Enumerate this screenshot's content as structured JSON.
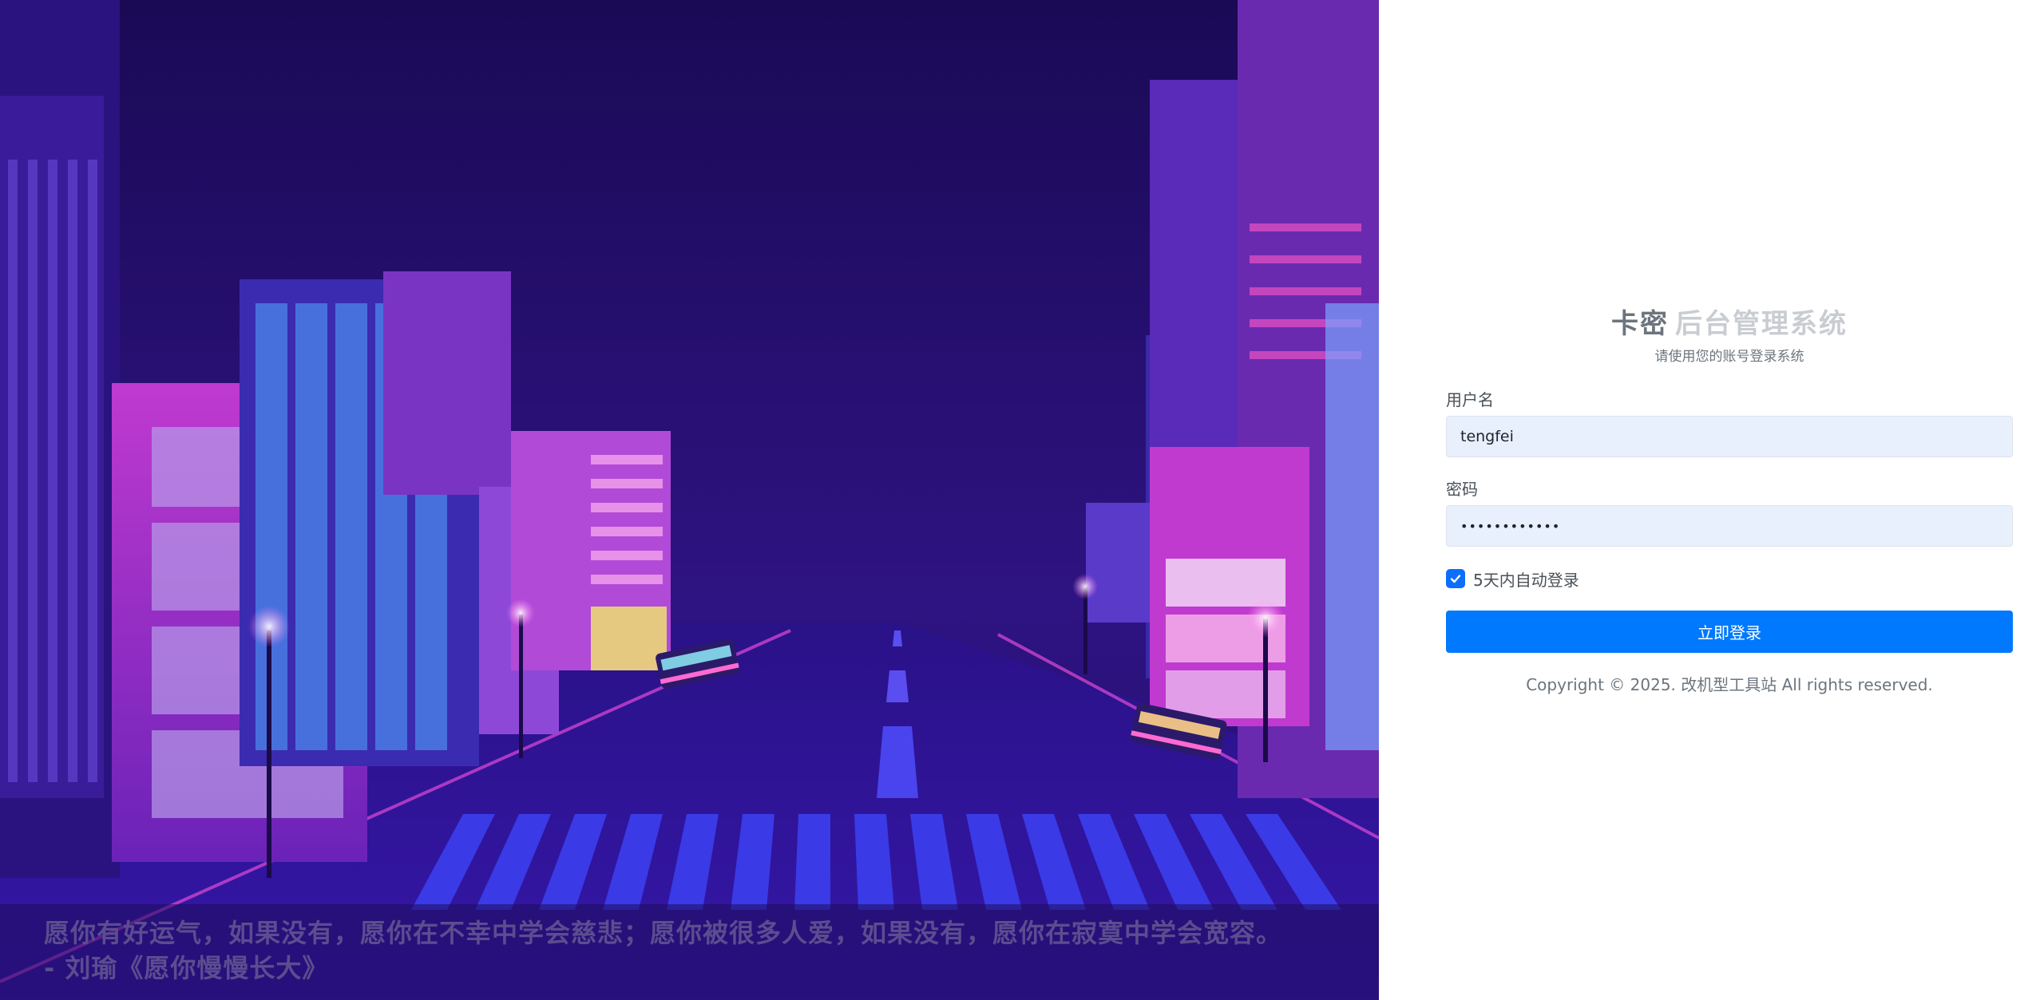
{
  "hero": {
    "quote": "愿你有好运气，如果没有，愿你在不幸中学会慈悲；愿你被很多人爱，如果没有，愿你在寂寞中学会宽容。 - 刘瑜《愿你慢慢长大》"
  },
  "login": {
    "title_main": "卡密",
    "title_sub": "后台管理系统",
    "subtitle": "请使用您的账号登录系统",
    "username_label": "用户名",
    "username_value": "tengfei",
    "password_label": "密码",
    "password_value": "••••••••••••",
    "remember_label": "5天内自动登录",
    "remember_checked": true,
    "submit_label": "立即登录",
    "copyright": "Copyright © 2025. 改机型工具站 All rights reserved."
  },
  "colors": {
    "primary": "#0079fe",
    "input_bg": "#e8f0fe",
    "hero_bg": "#250d6a"
  }
}
